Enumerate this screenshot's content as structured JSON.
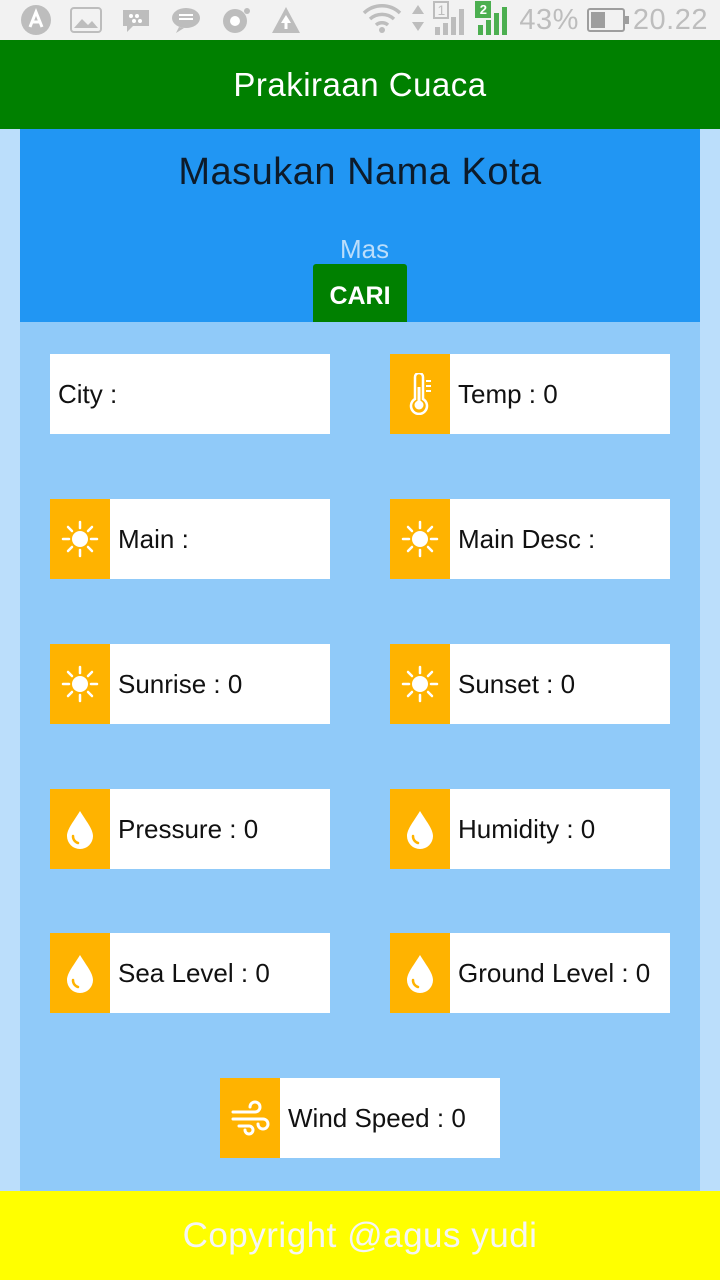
{
  "status_bar": {
    "battery_percent": "43%",
    "time": "20.22",
    "sim1_label": "1",
    "sim2_label": "2"
  },
  "app_bar": {
    "title": "Prakiraan Cuaca"
  },
  "search": {
    "heading": "Masukan Nama Kota",
    "input_placeholder": "Masukan Nama Kota",
    "input_value": "",
    "button_label": "CARI"
  },
  "cards": {
    "city": "City :",
    "temp": "Temp : 0",
    "main": "Main :",
    "main_desc": "Main Desc :",
    "sunrise": "Sunrise : 0",
    "sunset": "Sunset : 0",
    "pressure": "Pressure : 0",
    "humidity": "Humidity : 0",
    "sea_level": "Sea Level : 0",
    "ground_level": "Ground Level : 0",
    "wind_speed": "Wind Speed : 0"
  },
  "icons": {
    "temp": "thermometer-icon",
    "main": "sun-icon",
    "main_desc": "sun-icon",
    "sunrise": "sun-icon",
    "sunset": "sun-icon",
    "pressure": "water-drop-icon",
    "humidity": "water-drop-icon",
    "sea_level": "water-drop-icon",
    "ground_level": "water-drop-icon",
    "wind_speed": "wind-icon"
  },
  "colors": {
    "app_bar": "#008000",
    "search_panel": "#2196F3",
    "content_bg": "#90CAF9",
    "page_bg": "#BBDEFB",
    "icon_bg": "#FFB300",
    "footer_bg": "#FFFF00",
    "footer_text": "#F5F5F5"
  },
  "footer": {
    "text": "Copyright @agus yudi"
  }
}
